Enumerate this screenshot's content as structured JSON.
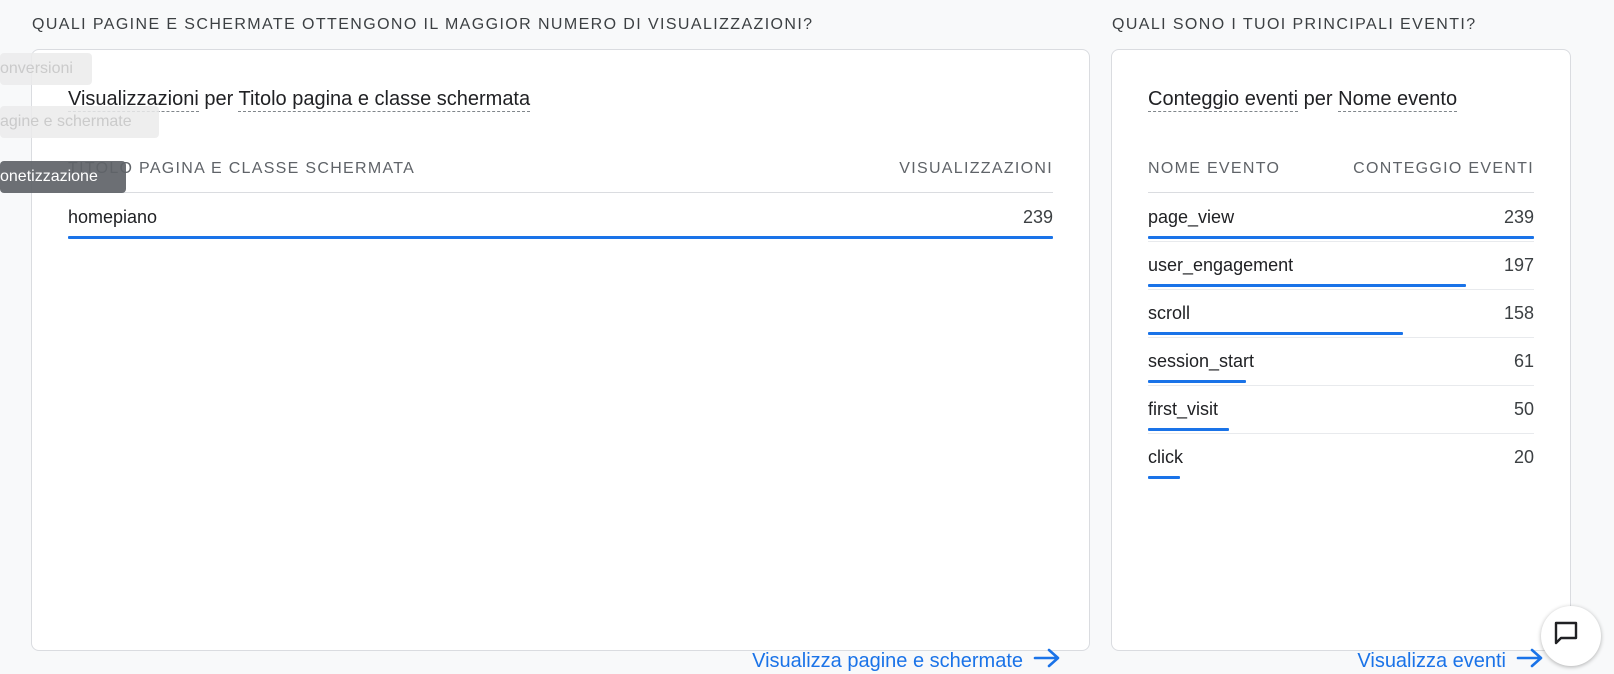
{
  "sections": {
    "pages_title": "QUALI PAGINE E SCHERMATE OTTENGONO IL MAGGIOR NUMERO DI VISUALIZZAZIONI?",
    "events_title": "QUALI SONO I TUOI PRINCIPALI EVENTI?"
  },
  "pages_card": {
    "metric": "Visualizzazioni",
    "per": "per",
    "dimension": "Titolo pagina e classe schermata",
    "col_left": "TITOLO PAGINA E CLASSE SCHERMATA",
    "col_right": "VISUALIZZAZIONI",
    "rows": [
      {
        "label": "homepiano",
        "value": "239",
        "fraction": 1.0
      }
    ],
    "link": "Visualizza pagine e schermate"
  },
  "events_card": {
    "metric": "Conteggio eventi",
    "per": "per",
    "dimension": "Nome evento",
    "col_left": "NOME EVENTO",
    "col_right": "CONTEGGIO EVENTI",
    "rows": [
      {
        "label": "page_view",
        "value": "239",
        "fraction": 1.0
      },
      {
        "label": "user_engagement",
        "value": "197",
        "fraction": 0.824
      },
      {
        "label": "scroll",
        "value": "158",
        "fraction": 0.661
      },
      {
        "label": "session_start",
        "value": "61",
        "fraction": 0.255
      },
      {
        "label": "first_visit",
        "value": "50",
        "fraction": 0.209
      },
      {
        "label": "click",
        "value": "20",
        "fraction": 0.084
      }
    ],
    "link": "Visualizza eventi"
  },
  "overlay_tooltips": [
    {
      "text": "onversioni",
      "style": "faded"
    },
    {
      "text": "agine e schermate",
      "style": "faded"
    },
    {
      "text": "onetizzazione",
      "style": "dark"
    }
  ],
  "icons": {
    "arrow": "arrow-right-icon",
    "chat": "feedback-chat-icon"
  },
  "colors": {
    "accent": "#1a73e8",
    "background": "#f8f9fa",
    "card": "#ffffff"
  }
}
